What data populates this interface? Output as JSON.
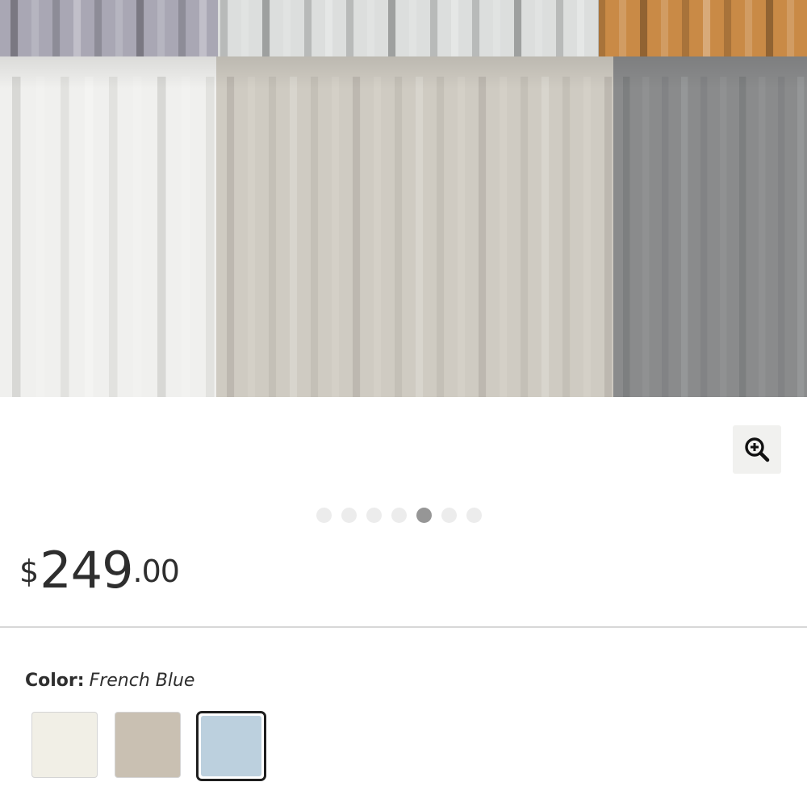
{
  "product": {
    "image_alt": "",
    "price": {
      "currency": "$",
      "dollars": "249",
      "cents": ".00"
    }
  },
  "gallery": {
    "dot_count": 7,
    "active_index": 4
  },
  "color": {
    "label": "Color:",
    "selected": "French Blue",
    "swatches": [
      {
        "color": "#f1efe6"
      },
      {
        "color": "#c9c0b2"
      },
      {
        "color": "#bcd0de"
      }
    ]
  },
  "image_colors": {
    "top_lavender": "#a9a7b4",
    "top_white": "#dcdedd",
    "top_orange": "#c98a46",
    "white_panel": "#f0f0ee",
    "greige_panel": "#cfcbc2",
    "grey_panel": "#8a8b8c"
  }
}
